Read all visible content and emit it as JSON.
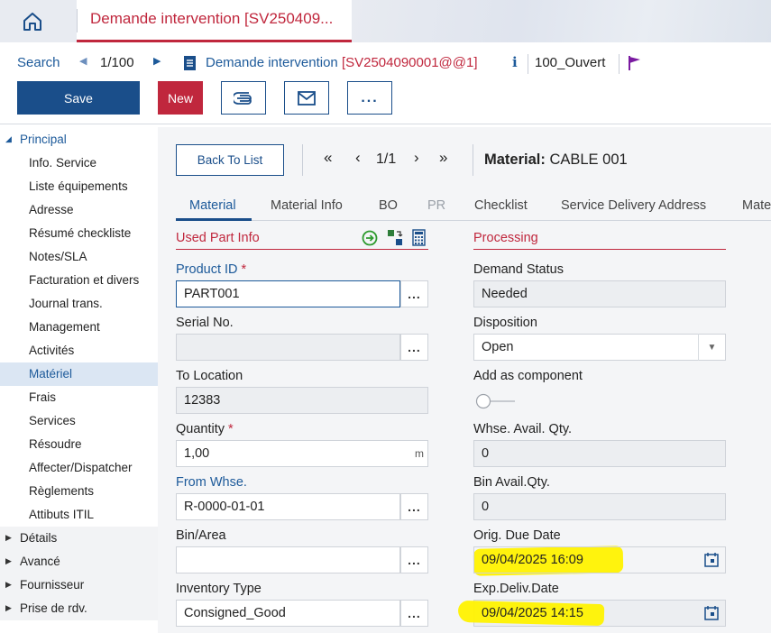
{
  "colors": {
    "brand_blue": "#1a4e8a",
    "accent_red": "#c0273d",
    "highlight": "#fff200",
    "flag": "#7a1aa1"
  },
  "topbar": {
    "home_icon": "home-icon",
    "tab_title": "Demande intervention [SV250409..."
  },
  "nav": {
    "search_label": "Search",
    "counter": "1/100",
    "doc_title": "Demande intervention ",
    "doc_id": "[SV2504090001@@1]",
    "info": "i",
    "status": "100_Ouvert",
    "flag_icon": "flag-icon"
  },
  "actions": {
    "save_label": "Save",
    "new_label": "New",
    "attach_icon": "paperclip-icon",
    "mail_icon": "envelope-icon",
    "more_label": "..."
  },
  "sidebar": {
    "principal": "Principal",
    "items": [
      "Info. Service",
      "Liste équipements",
      "Adresse",
      "Résumé checkliste",
      "Notes/SLA",
      "Facturation et divers",
      "Journal trans.",
      "Management",
      "Activités",
      "Matériel",
      "Frais",
      "Services",
      "Résoudre",
      "Affecter/Dispatcher",
      "Règlements",
      "Attibuts ITIL"
    ],
    "selected": "Matériel",
    "groups": [
      "Détails",
      "Avancé",
      "Fournisseur",
      "Prise de rdv."
    ]
  },
  "main": {
    "back_label": "Back To List",
    "pager": "1/1",
    "material_label": "Material:",
    "material_value": "CABLE 001",
    "tabs": [
      "Material",
      "Material Info",
      "BO",
      "PR",
      "Checklist",
      "Service Delivery Address",
      "Mate"
    ],
    "active_tab": "Material",
    "left_section": "Used Part Info",
    "right_section": "Processing",
    "fields": {
      "product_id": {
        "label": "Product ID",
        "value": "PART001"
      },
      "serial_no": {
        "label": "Serial No.",
        "value": ""
      },
      "to_location": {
        "label": "To Location",
        "value": "12383"
      },
      "quantity": {
        "label": "Quantity",
        "value": "1,00",
        "unit": "m"
      },
      "from_whse": {
        "label": "From Whse.",
        "value": "R-0000-01-01"
      },
      "bin_area": {
        "label": "Bin/Area",
        "value": ""
      },
      "inventory_type": {
        "label": "Inventory Type",
        "value": "Consigned_Good"
      },
      "demand_status": {
        "label": "Demand Status",
        "value": "Needed"
      },
      "disposition": {
        "label": "Disposition",
        "value": "Open"
      },
      "add_component": {
        "label": "Add as component",
        "checked": false
      },
      "whse_avail": {
        "label": "Whse. Avail. Qty.",
        "value": "0"
      },
      "bin_avail": {
        "label": "Bin Avail.Qty.",
        "value": "0"
      },
      "orig_due": {
        "label": "Orig. Due Date",
        "value": "09/04/2025 16:09"
      },
      "exp_deliv": {
        "label": "Exp.Deliv.Date",
        "value": "09/04/2025 14:15"
      }
    },
    "required_mark": "*",
    "more_label": "..."
  }
}
